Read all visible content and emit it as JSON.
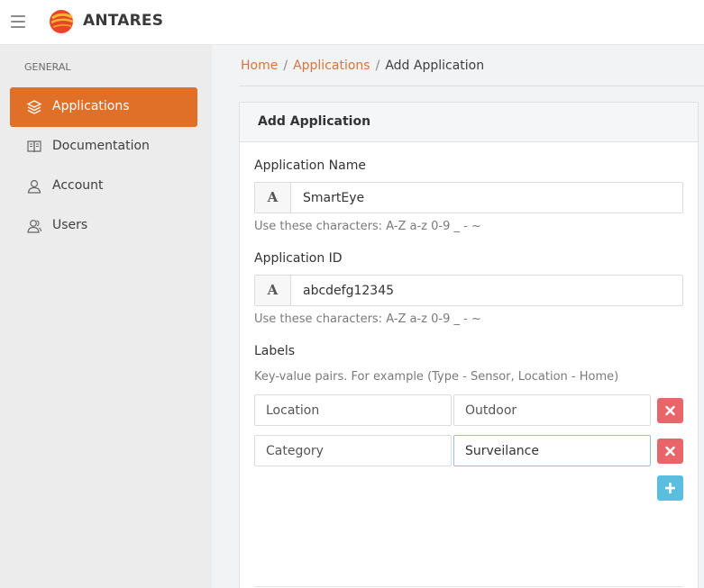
{
  "header": {
    "brand": "ANTARES",
    "menu_icon": "hamburger-menu-icon",
    "logo_icon": "antares-logo-icon"
  },
  "sidebar": {
    "group_label": "GENERAL",
    "items": [
      {
        "label": "Applications",
        "icon": "layers-icon",
        "active": true
      },
      {
        "label": "Documentation",
        "icon": "book-icon",
        "active": false
      },
      {
        "label": "Account",
        "icon": "user-icon",
        "active": false
      },
      {
        "label": "Users",
        "icon": "users-icon",
        "active": false
      }
    ]
  },
  "breadcrumb": {
    "home": "Home",
    "separator": "/",
    "applications": "Applications",
    "current": "Add Application"
  },
  "form": {
    "title": "Add Application",
    "app_name": {
      "label": "Application Name",
      "addon": "A",
      "value": "SmartEye",
      "hint": "Use these characters: A-Z a-z 0-9 _ - ~"
    },
    "app_id": {
      "label": "Application ID",
      "addon": "A",
      "value": "abcdefg12345",
      "hint": "Use these characters: A-Z a-z 0-9 _ - ~"
    },
    "labels": {
      "label": "Labels",
      "hint": "Key-value pairs. For example (Type - Sensor, Location - Home)",
      "pairs": [
        {
          "key": "Location",
          "value": "Outdoor"
        },
        {
          "key": "Category",
          "value": "Surveilance"
        }
      ],
      "remove_icon": "close-icon",
      "add_icon": "plus-icon"
    }
  },
  "colors": {
    "accent": "#e07028",
    "link": "#d9743a",
    "danger": "#e8666a",
    "info": "#5bbde0"
  }
}
